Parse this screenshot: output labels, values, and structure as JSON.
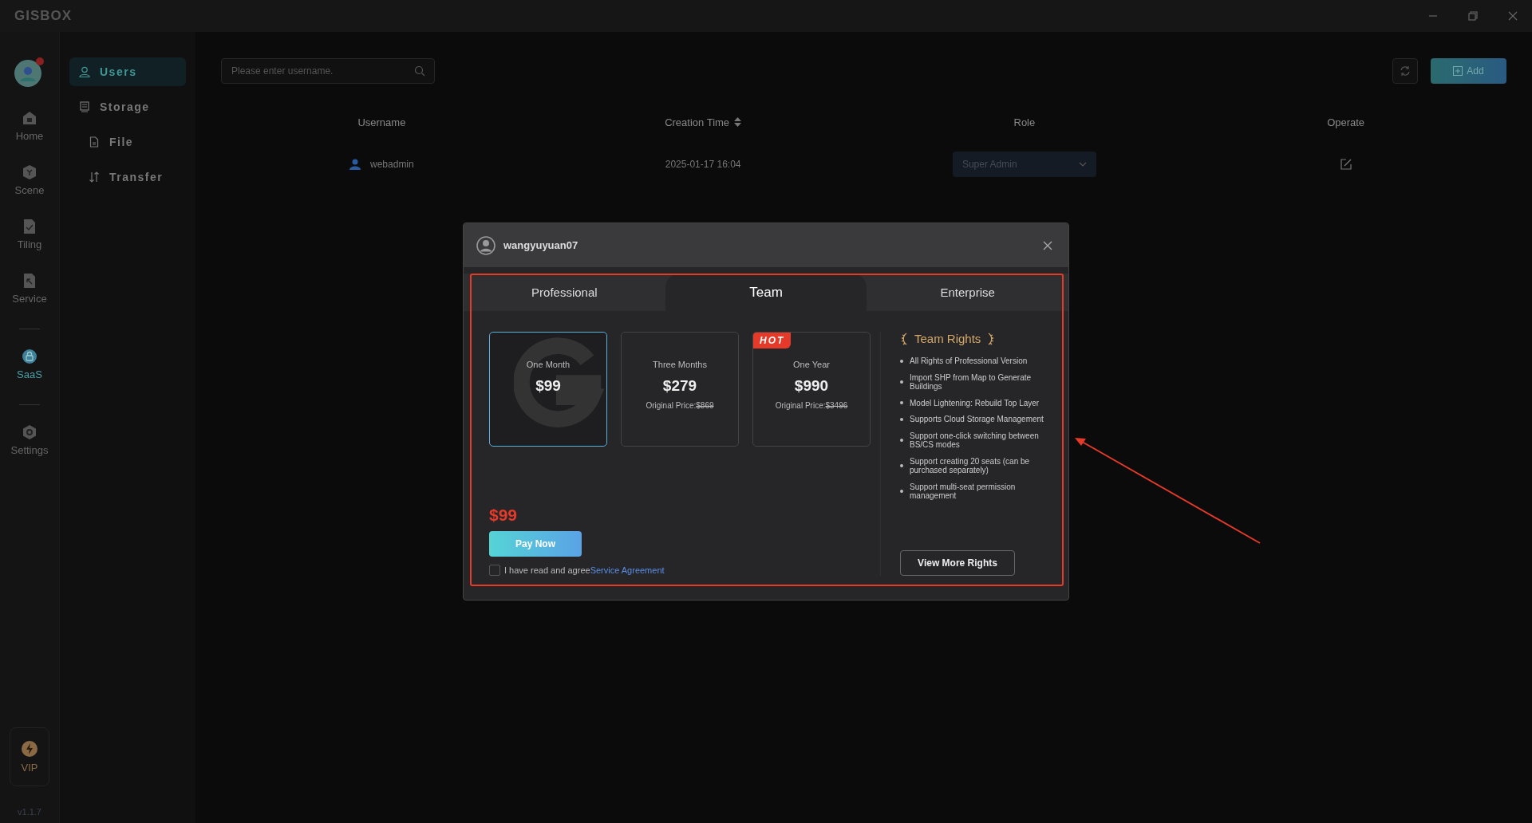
{
  "app": {
    "logo": "GISBOX"
  },
  "nav_rail": {
    "items": [
      {
        "label": "Home",
        "selected": false
      },
      {
        "label": "Scene",
        "selected": false
      },
      {
        "label": "Tiling",
        "selected": false
      },
      {
        "label": "Service",
        "selected": false
      },
      {
        "label": "SaaS",
        "selected": true
      },
      {
        "label": "Settings",
        "selected": false
      }
    ],
    "vip": "VIP",
    "version": "v1.1.7"
  },
  "sub_nav": [
    {
      "label": "Users",
      "selected": true
    },
    {
      "label": "Storage",
      "selected": false,
      "children": [
        {
          "label": "File",
          "selected": false
        },
        {
          "label": "Transfer",
          "selected": false
        }
      ]
    }
  ],
  "search": {
    "placeholder": "Please enter username."
  },
  "add_button": "Add",
  "table": {
    "columns": [
      {
        "label": "Username",
        "sortable": false
      },
      {
        "label": "Creation Time",
        "sortable": true
      },
      {
        "label": "Role",
        "sortable": false
      },
      {
        "label": "Operate",
        "sortable": false
      }
    ],
    "rows": [
      {
        "username": "webadmin",
        "creation_time": "2025-01-17 16:04",
        "role": "Super Admin"
      }
    ]
  },
  "dialog": {
    "username": "wangyuyuan07",
    "tabs": [
      {
        "label": "Professional",
        "selected": false
      },
      {
        "label": "Team",
        "selected": true
      },
      {
        "label": "Enterprise",
        "selected": false
      }
    ],
    "plans": [
      {
        "period": "One Month",
        "price": "$99",
        "selected": true
      },
      {
        "period": "Three Months",
        "price": "$279",
        "original_label": "Original Price:",
        "original_price": "$869",
        "selected": false
      },
      {
        "period": "One Year",
        "price": "$990",
        "original_label": "Original Price:",
        "original_price": "$3496",
        "badge": "HOT",
        "selected": false
      }
    ],
    "total": "$99",
    "pay_button": "Pay Now",
    "agreement": {
      "checked": false,
      "text": "I have read and agree",
      "link": "Service Agreement"
    },
    "rights": {
      "title": "Team Rights",
      "items": [
        "All Rights of Professional Version",
        "Import SHP from Map to Generate Buildings",
        "Model Lightening: Rebuild Top Layer",
        "Supports Cloud Storage Management",
        "Support one-click switching between BS/CS modes",
        "Support creating 20 seats (can be purchased separately)",
        "Support multi-seat permission management"
      ],
      "button": "View More Rights"
    }
  }
}
